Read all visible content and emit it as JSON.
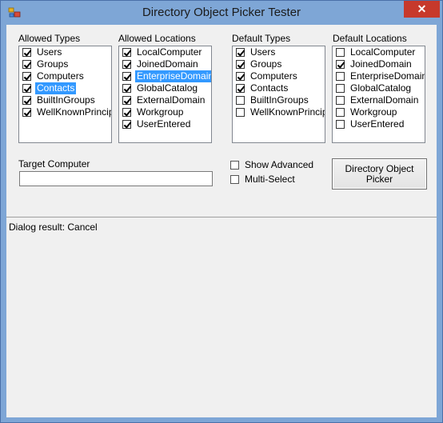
{
  "window": {
    "title": "Directory Object Picker Tester",
    "close_glyph": "✕"
  },
  "allowed_types": {
    "label": "Allowed Types",
    "items": [
      {
        "label": "Users",
        "checked": true,
        "selected": false
      },
      {
        "label": "Groups",
        "checked": true,
        "selected": false
      },
      {
        "label": "Computers",
        "checked": true,
        "selected": false
      },
      {
        "label": "Contacts",
        "checked": true,
        "selected": true
      },
      {
        "label": "BuiltInGroups",
        "checked": true,
        "selected": false
      },
      {
        "label": "WellKnownPrincipal",
        "checked": true,
        "selected": false
      }
    ]
  },
  "allowed_locations": {
    "label": "Allowed Locations",
    "items": [
      {
        "label": "LocalComputer",
        "checked": true,
        "selected": false
      },
      {
        "label": "JoinedDomain",
        "checked": true,
        "selected": false
      },
      {
        "label": "EnterpriseDomain",
        "checked": true,
        "selected": true
      },
      {
        "label": "GlobalCatalog",
        "checked": true,
        "selected": false
      },
      {
        "label": "ExternalDomain",
        "checked": true,
        "selected": false
      },
      {
        "label": "Workgroup",
        "checked": true,
        "selected": false
      },
      {
        "label": "UserEntered",
        "checked": true,
        "selected": false
      }
    ]
  },
  "default_types": {
    "label": "Default Types",
    "items": [
      {
        "label": "Users",
        "checked": true,
        "selected": false
      },
      {
        "label": "Groups",
        "checked": true,
        "selected": false
      },
      {
        "label": "Computers",
        "checked": true,
        "selected": false
      },
      {
        "label": "Contacts",
        "checked": true,
        "selected": false
      },
      {
        "label": "BuiltInGroups",
        "checked": false,
        "selected": false
      },
      {
        "label": "WellKnownPrincipal",
        "checked": false,
        "selected": false
      }
    ]
  },
  "default_locations": {
    "label": "Default Locations",
    "items": [
      {
        "label": "LocalComputer",
        "checked": false,
        "selected": false
      },
      {
        "label": "JoinedDomain",
        "checked": true,
        "selected": false
      },
      {
        "label": "EnterpriseDomain",
        "checked": false,
        "selected": false
      },
      {
        "label": "GlobalCatalog",
        "checked": false,
        "selected": false
      },
      {
        "label": "ExternalDomain",
        "checked": false,
        "selected": false
      },
      {
        "label": "Workgroup",
        "checked": false,
        "selected": false
      },
      {
        "label": "UserEntered",
        "checked": false,
        "selected": false
      }
    ]
  },
  "target_computer": {
    "label": "Target Computer",
    "value": ""
  },
  "options": {
    "show_advanced": {
      "label": "Show Advanced",
      "checked": false
    },
    "multi_select": {
      "label": "Multi-Select",
      "checked": false
    }
  },
  "picker_button": {
    "line1": "Directory Object",
    "line2": "Picker"
  },
  "result": {
    "text": "Dialog result: Cancel"
  },
  "colors": {
    "selection": "#3399ff",
    "close": "#c7392b",
    "frame": "#7ea6d6"
  }
}
